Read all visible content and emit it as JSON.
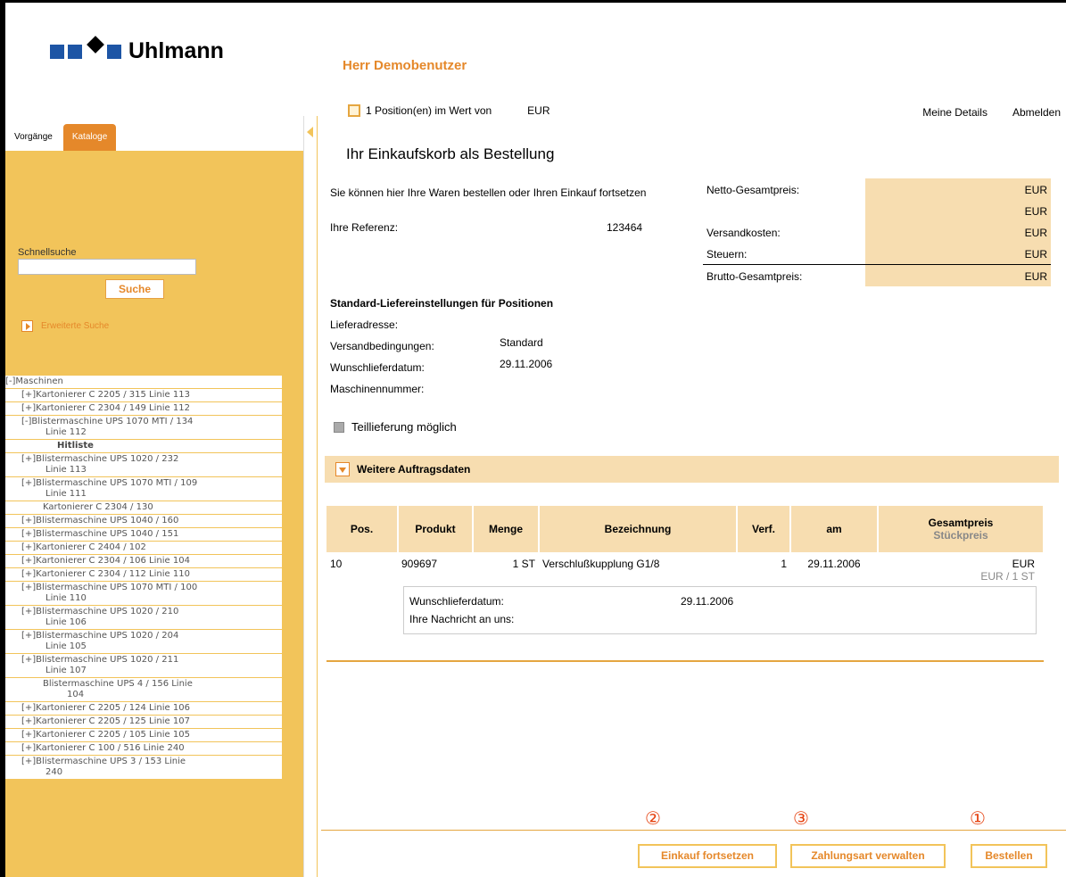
{
  "brand": {
    "name": "Uhlmann"
  },
  "sidebar": {
    "tabs": [
      {
        "label": "Vorgänge",
        "active": false
      },
      {
        "label": "Kataloge",
        "active": true
      }
    ],
    "quick_search_label": "Schnellsuche",
    "quick_search_value": "",
    "search_button": "Suche",
    "advanced_search": "Erweiterte Suche",
    "tree": [
      {
        "label": "[-]Maschinen",
        "level": 0
      },
      {
        "label": "[+]Kartonierer C 2205 / 315 Linie 113",
        "level": 1
      },
      {
        "label": "[+]Kartonierer C 2304 / 149 Linie 112",
        "level": 1
      },
      {
        "label": "[-]Blistermaschine UPS 1070 MTI / 134",
        "cont": "Linie 112",
        "level": 1
      },
      {
        "label": "Hitliste",
        "level": "hit"
      },
      {
        "label": "[+]Blistermaschine UPS 1020 / 232",
        "cont": "Linie 113",
        "level": 1
      },
      {
        "label": "[+]Blistermaschine UPS 1070 MTI / 109",
        "cont": "Linie 111",
        "level": 1
      },
      {
        "label": "Kartonierer C 2304 / 130",
        "level": "plain"
      },
      {
        "label": "[+]Blistermaschine UPS 1040 / 160",
        "level": 1
      },
      {
        "label": "[+]Blistermaschine UPS 1040 / 151",
        "level": 1
      },
      {
        "label": "[+]Kartonierer C 2404 / 102",
        "level": 1
      },
      {
        "label": "[+]Kartonierer C 2304 / 106 Linie 104",
        "level": 1
      },
      {
        "label": "[+]Kartonierer C 2304 / 112 Linie 110",
        "level": 1
      },
      {
        "label": "[+]Blistermaschine UPS 1070 MTI / 100",
        "cont": "Linie 110",
        "level": 1
      },
      {
        "label": "[+]Blistermaschine UPS 1020 / 210",
        "cont": "Linie 106",
        "level": 1
      },
      {
        "label": "[+]Blistermaschine UPS 1020 / 204",
        "cont": "Linie 105",
        "level": 1
      },
      {
        "label": "[+]Blistermaschine UPS 1020 / 211",
        "cont": "Linie 107",
        "level": 1
      },
      {
        "label": "Blistermaschine UPS 4 / 156 Linie",
        "cont": "104",
        "level": "plain"
      },
      {
        "label": "[+]Kartonierer C 2205 / 124 Linie 106",
        "level": 1
      },
      {
        "label": "[+]Kartonierer C 2205 / 125 Linie 107",
        "level": 1
      },
      {
        "label": "[+]Kartonierer C 2205 / 105 Linie 105",
        "level": 1
      },
      {
        "label": "[+]Kartonierer C 100 / 516 Linie 240",
        "level": 1
      },
      {
        "label": "[+]Blistermaschine UPS 3 / 153 Linie",
        "cont": "240",
        "level": 1
      }
    ]
  },
  "header": {
    "user": "Herr Demobenutzer",
    "cart_text": "1 Position(en) im Wert von",
    "cart_currency": "EUR",
    "links": [
      "Meine Details",
      "Abmelden"
    ]
  },
  "order": {
    "title": "Ihr Einkaufskorb als Bestellung",
    "intro": "Sie können hier Ihre Waren bestellen oder Ihren Einkauf fortsetzen",
    "reference_label": "Ihre Referenz:",
    "reference_value": "123464",
    "totals": [
      {
        "label": "Netto-Gesamtpreis:",
        "value": "EUR"
      },
      {
        "label": "",
        "value": "EUR"
      },
      {
        "label": "Versandkosten:",
        "value": "EUR"
      },
      {
        "label": "Steuern:",
        "value": "EUR"
      },
      {
        "label": "Brutto-Gesamtpreis:",
        "value": "EUR"
      }
    ],
    "std_title": "Standard-Liefereinstellungen für Positionen",
    "std": [
      {
        "label": "Lieferadresse:",
        "value": ""
      },
      {
        "label": "Versandbedingungen:",
        "value": "Standard"
      },
      {
        "label": "Wunschlieferdatum:",
        "value": "29.11.2006"
      },
      {
        "label": "Maschinennummer:",
        "value": ""
      }
    ],
    "partial_delivery": "Teillieferung möglich",
    "more_data": "Weitere Auftragsdaten"
  },
  "table": {
    "headers": [
      "Pos.",
      "Produkt",
      "Menge",
      "Bezeichnung",
      "Verf.",
      "am",
      "Gesamtpreis"
    ],
    "header_sub": "Stückpreis",
    "rows": [
      {
        "pos": "10",
        "produkt": "909697",
        "menge": "1 ST",
        "bezeichnung": "Verschlußkupplung G1/8",
        "verf": "1",
        "am": "29.11.2006",
        "gesamt": "EUR",
        "stueck": "EUR / 1 ST",
        "detail_date_label": "Wunschlieferdatum:",
        "detail_date": "29.11.2006",
        "detail_msg_label": "Ihre Nachricht an uns:"
      }
    ]
  },
  "buttons": {
    "continue": "Einkauf fortsetzen",
    "payment": "Zahlungsart verwalten",
    "order": "Bestellen"
  },
  "markers": {
    "continue": "②",
    "payment": "③",
    "order": "①"
  }
}
